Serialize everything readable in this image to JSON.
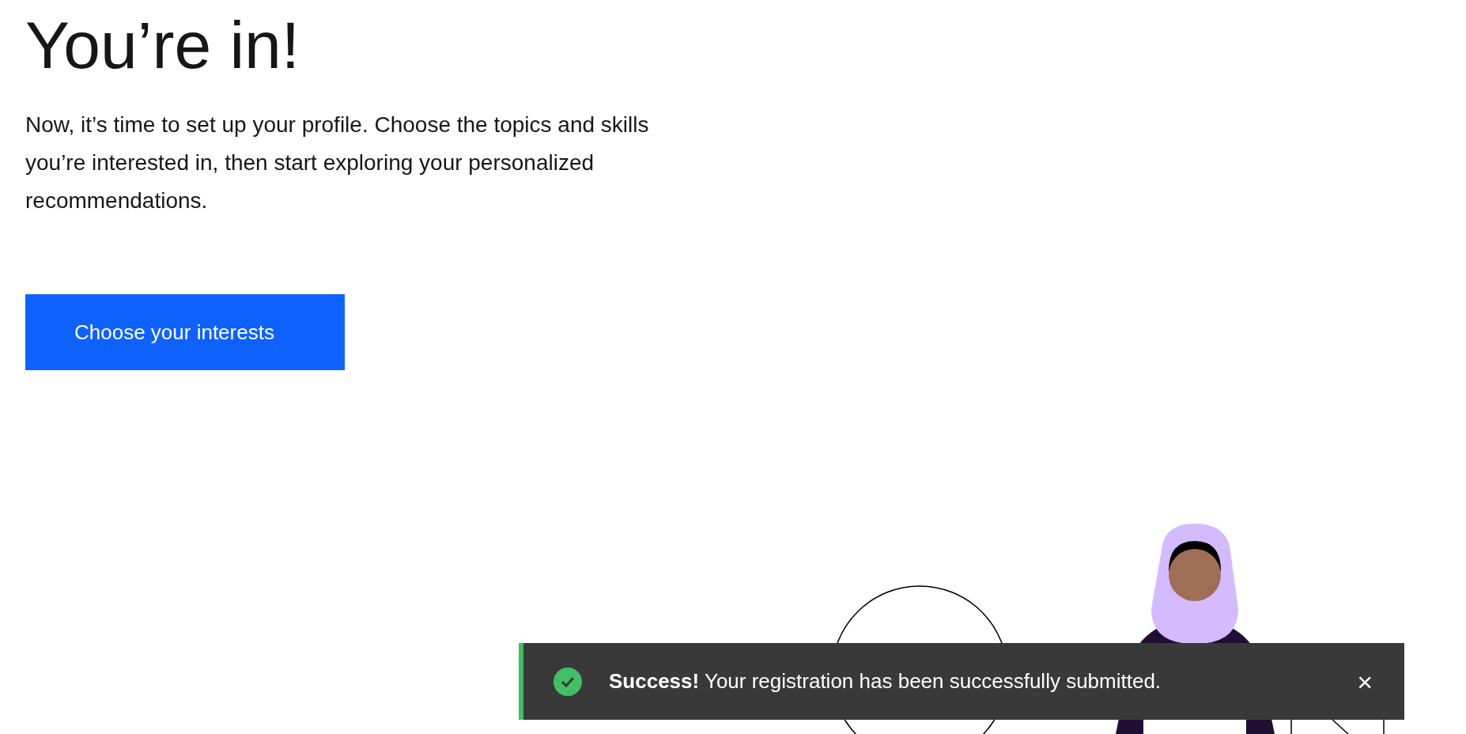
{
  "heading": "You’re in!",
  "intro": "Now, it’s time to set up your profile. Choose the topics and skills you’re interested in, then start exploring your personalized recommendations.",
  "primary_button": "Choose your interests",
  "toast": {
    "kind": "success",
    "message": "**Success!** Your registration has been successfully submitted.",
    "close": "×"
  }
}
